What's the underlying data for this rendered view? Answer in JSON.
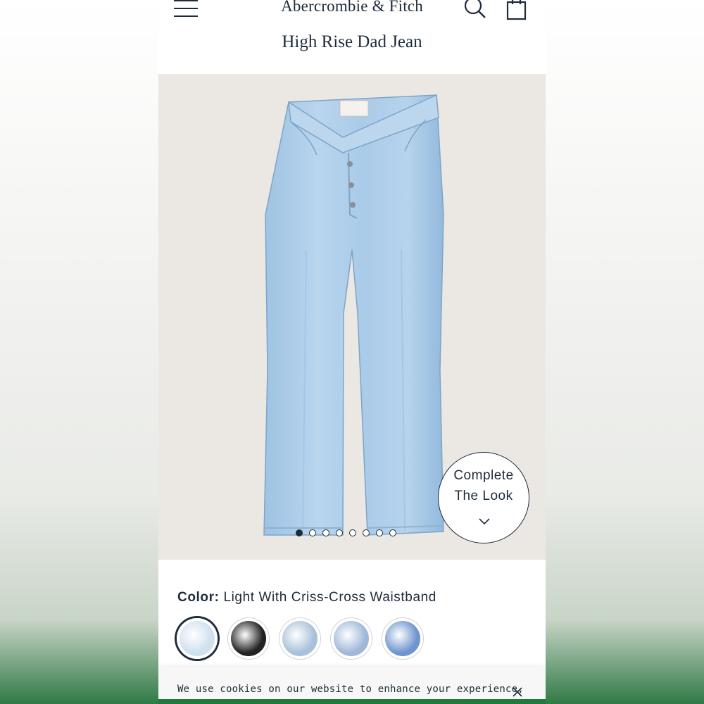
{
  "header": {
    "brand": "Abercrombie & Fitch",
    "menu_icon": "menu-icon",
    "search_icon": "search-icon",
    "bag_icon": "shopping-bag-icon"
  },
  "product": {
    "title": "High Rise Dad Jean"
  },
  "gallery": {
    "image": "light-wash-jeans-photo",
    "dots_total": 8,
    "active_dot": 1,
    "complete_look": {
      "line1": "Complete",
      "line2": "The Look",
      "icon": "chevron-down-icon"
    }
  },
  "color": {
    "label": "Color:",
    "value": "Light With Criss-Cross Waistband",
    "swatches": [
      {
        "name": "light-wash",
        "color": "#cfe0ef",
        "selected": true
      },
      {
        "name": "black",
        "color": "#222222",
        "selected": false
      },
      {
        "name": "light-destroyed",
        "color": "#a9c1da",
        "selected": false
      },
      {
        "name": "medium-light",
        "color": "#9fb8d8",
        "selected": false
      },
      {
        "name": "medium",
        "color": "#6f95cf",
        "selected": false
      }
    ]
  },
  "cookie_banner": {
    "text": "We use cookies on our website to enhance your experience,",
    "close_icon": "close-icon"
  },
  "colors": {
    "ink": "#1d2b3a",
    "image_bg": "#ebe8e4",
    "accent_green": "#1f7a3c"
  }
}
